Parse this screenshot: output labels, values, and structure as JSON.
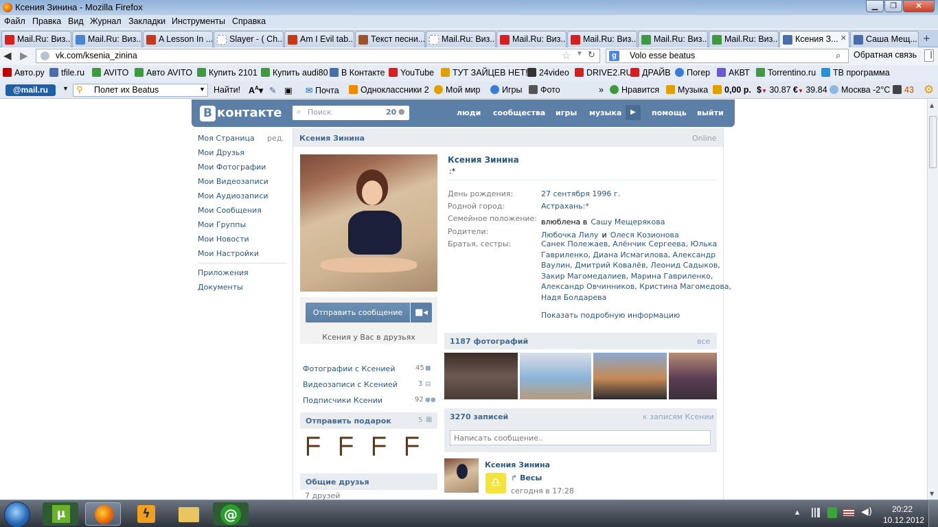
{
  "window": {
    "title": "Ксения Зинина - Mozilla Firefox"
  },
  "menu": [
    "Файл",
    "Правка",
    "Вид",
    "Журнал",
    "Закладки",
    "Инструменты",
    "Справка"
  ],
  "tabs": [
    {
      "label": "Mail.Ru: Виз...",
      "color": "#d62020"
    },
    {
      "label": "Mail.Ru: Виз...",
      "color": "#4a86cf"
    },
    {
      "label": "A Lesson In ...",
      "color": "#c23a1a"
    },
    {
      "label": "Slayer - ( Ch...",
      "color": "#999999"
    },
    {
      "label": "Am I Evil tab...",
      "color": "#c23a1a"
    },
    {
      "label": "Текст песни...",
      "color": "#a0522d"
    },
    {
      "label": "Mail.Ru: Виз...",
      "color": "#999999"
    },
    {
      "label": "Mail.Ru: Виз...",
      "color": "#d62020"
    },
    {
      "label": "Mail.Ru: Виз...",
      "color": "#d62020"
    },
    {
      "label": "Mail.Ru: Виз...",
      "color": "#3f9a3f"
    },
    {
      "label": "Mail.Ru: Виз...",
      "color": "#3f9a3f"
    },
    {
      "label": "Ксения З...",
      "color": "#4a6ea9"
    },
    {
      "label": "Саша Мещ...",
      "color": "#4a6ea9"
    }
  ],
  "nav": {
    "url": "vk.com/ksenia_zinina",
    "search": "Volo esse beatus",
    "feedback": "Обратная связь"
  },
  "bookmarks": [
    {
      "label": "Авто.ру",
      "color": "#c00000"
    },
    {
      "label": "tfile.ru",
      "color": "#4a6ea9"
    },
    {
      "label": "AVITO",
      "color": "#3f9a3f"
    },
    {
      "label": "Авто AVITO",
      "color": "#3f9a3f"
    },
    {
      "label": "Купить 2101",
      "color": "#3f9a3f"
    },
    {
      "label": "Купить audi80",
      "color": "#3f9a3f"
    },
    {
      "label": "В Контакте",
      "color": "#4a6ea9"
    },
    {
      "label": "YouTube",
      "color": "#d62020"
    },
    {
      "label": "ТУТ ЗАЙЦЕВ НЕТ!",
      "color": "#e0a000"
    },
    {
      "label": "24video",
      "color": "#333333"
    },
    {
      "label": "DRIVE2.RU",
      "color": "#d62020"
    },
    {
      "label": "ДРАЙВ",
      "color": "#d62020"
    },
    {
      "label": "Погер",
      "color": "#3a7bd5"
    },
    {
      "label": "АКВТ",
      "color": "#6a5acd"
    },
    {
      "label": "Torrentino.ru",
      "color": "#3f9a3f"
    },
    {
      "label": "ТВ программа",
      "color": "#2a8fd5"
    }
  ],
  "mailbar": {
    "logo": "@mail.ru",
    "search_value": "Полет их Beatus",
    "find": "Найти!",
    "items": [
      "Почта",
      "Одноклассники 2",
      "Мой мир",
      "Игры",
      "Фото"
    ],
    "like": "Нравится",
    "music": "Музыка",
    "balance": "0,00 р.",
    "usd": "30.87",
    "eur": "39.84",
    "weather": "Москва -2°C",
    "notif": "43"
  },
  "vk": {
    "logo": "контакте",
    "search_placeholder": "Поиск",
    "search_count": "20",
    "nav": [
      "люди",
      "сообщества",
      "игры",
      "музыка",
      "помощь",
      "выйти"
    ],
    "left_menu": [
      "Моя Страница",
      "Мои Друзья",
      "Мои Фотографии",
      "Мои Видеозаписи",
      "Мои Аудиозаписи",
      "Мои Сообщения",
      "Мои Группы",
      "Мои Новости",
      "Мои Настройки"
    ],
    "edit": "ред.",
    "left_extra": [
      "Приложения",
      "Документы"
    ],
    "profile": {
      "header_name": "Ксения Зинина",
      "online": "Online",
      "name": "Ксения Зинина",
      "status": ":*",
      "birthday_label": "День рождения:",
      "birthday": "27 сентября 1996 г.",
      "hometown_label": "Родной город:",
      "hometown": "Астрахань:*",
      "family_label": "Семейное положение:",
      "family_prefix": "влюблена в",
      "family_link": "Сашу Мещерякова",
      "parents_label": "Родители:",
      "parent1": "Любочка Лилу",
      "parents_and": "и",
      "parent2": "Олеся Козионова",
      "siblings_label": "Братья, сестры:",
      "siblings": [
        "Санек Полежаев, Алёнчик Сергеева, Юлька",
        "Гавриленко, Диана Исмагилова, Александр",
        "Ваулин, Дмитрий Ковалёв, Леонид Садыков,",
        "Закир Магомедалиев, Марина Гавриленко,",
        "Александр Овчинников, Кристина Магомедова,",
        "Надя Болдарева"
      ],
      "more_info": "Показать подробную информацию",
      "send_message": "Отправить сообщение",
      "friends_note": "Ксения у Вас в друзьях",
      "side_links": [
        {
          "label": "Фотографии с Ксенией",
          "count": "45"
        },
        {
          "label": "Видеозаписи с Ксенией",
          "count": "3"
        },
        {
          "label": "Подписчики Ксении",
          "count": "92"
        }
      ],
      "gifts_title": "Отправить подарок",
      "gifts_count": "5",
      "mutual_title": "Общие друзья",
      "mutual_count": "7 друзей",
      "photos_title": "1187 фотографий",
      "photos_all": "все",
      "posts_title": "3270 записей",
      "posts_link": "к записям Ксении",
      "post_placeholder": "Написать сообщение..",
      "post_author": "Ксения Зинина",
      "post_title": "Весы",
      "post_time": "сегодня в 17:28"
    }
  },
  "taskbar": {
    "time": "20:22",
    "date": "10.12.2012"
  }
}
